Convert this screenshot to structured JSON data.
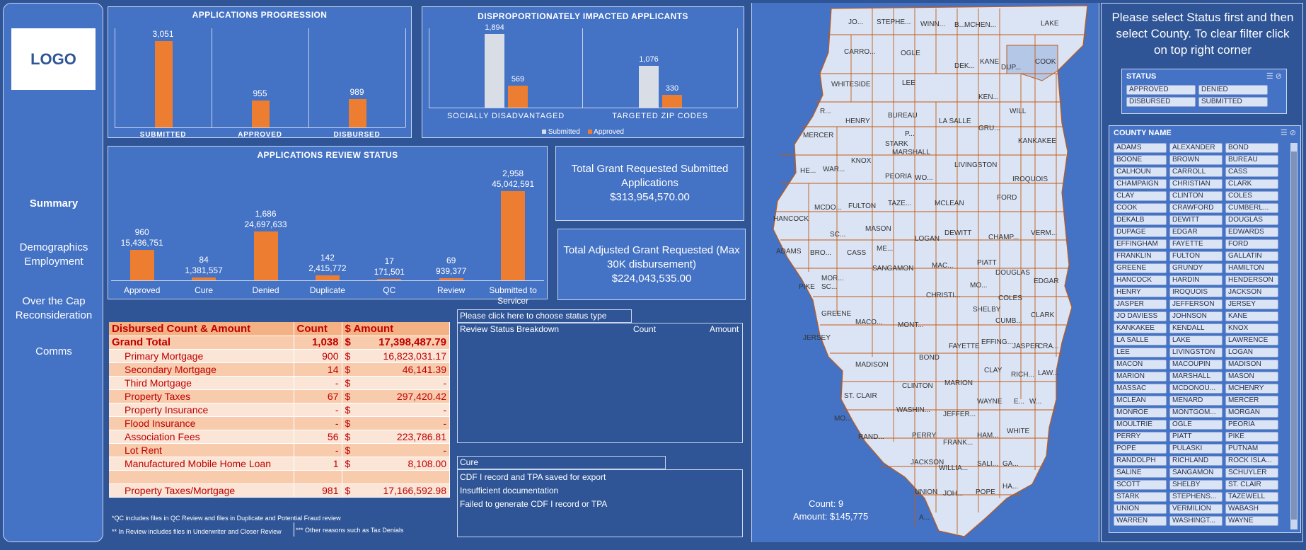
{
  "nav": {
    "logo": "LOGO",
    "items": [
      "Summary",
      "Demographics Employment",
      "Over the Cap Reconsideration",
      "Comms"
    ]
  },
  "progression": {
    "title": "APPLICATIONS PROGRESSION",
    "chart_data": {
      "type": "bar",
      "categories": [
        "SUBMITTED",
        "APPROVED",
        "DISBURSED"
      ],
      "values": [
        3051,
        955,
        989
      ],
      "value_labels": [
        "3,051",
        "955",
        "989"
      ],
      "ylim": [
        0,
        3300
      ]
    }
  },
  "disproportionate": {
    "title": "DISPROPORTIONATELY IMPACTED APPLICANTS",
    "chart_data": {
      "type": "bar",
      "categories": [
        "SOCIALLY DISADVANTAGED",
        "TARGETED ZIP CODES"
      ],
      "series": [
        {
          "name": "Submitted",
          "values": [
            1894,
            1076
          ],
          "labels": [
            "1,894",
            "1,076"
          ],
          "color": "#d9dde6"
        },
        {
          "name": "Approved",
          "values": [
            569,
            330
          ],
          "labels": [
            "569",
            "330"
          ],
          "color": "#ed7d31"
        }
      ],
      "ylim": [
        0,
        2000
      ],
      "legend": "bottom"
    }
  },
  "review": {
    "title": "APPLICATIONS REVIEW STATUS",
    "chart_data": {
      "type": "bar",
      "categories": [
        "Approved",
        "Cure",
        "Denied",
        "Duplicate",
        "QC",
        "Review",
        "Submitted to Servicer"
      ],
      "counts": [
        "960",
        "84",
        "1,686",
        "142",
        "17",
        "69",
        "2,958"
      ],
      "amounts_label": [
        "15,436,751",
        "1,381,557",
        "24,697,633",
        "2,415,772",
        "171,501",
        "939,377",
        "45,042,591"
      ],
      "values": [
        15436751,
        1381557,
        24697633,
        2415772,
        171501,
        939377,
        45042591
      ],
      "ylim": [
        0,
        48000000
      ]
    }
  },
  "kpi1": {
    "line1": "Total Grant Requested Submitted",
    "line2": "Applications",
    "value": "$313,954,570.00"
  },
  "kpi2": {
    "line1": "Total Adjusted Grant Requested (Max",
    "line2": "30K disbursement)",
    "value": "$224,043,535.00"
  },
  "disbursed": {
    "header": [
      "Disbursed Count & Amount",
      "Count",
      "$ Amount"
    ],
    "total": {
      "label": "Grand Total",
      "count": "1,038",
      "currency": "$",
      "amount": "17,398,487.79"
    },
    "rows": [
      {
        "label": "Primary Mortgage",
        "count": "900",
        "currency": "$",
        "amount": "16,823,031.17"
      },
      {
        "label": "Secondary Mortgage",
        "count": "14",
        "currency": "$",
        "amount": "46,141.39"
      },
      {
        "label": "Third Mortgage",
        "count": "-",
        "currency": "$",
        "amount": "-"
      },
      {
        "label": "Property Taxes",
        "count": "67",
        "currency": "$",
        "amount": "297,420.42"
      },
      {
        "label": "Property Insurance",
        "count": "-",
        "currency": "$",
        "amount": "-"
      },
      {
        "label": "Flood Insurance",
        "count": "-",
        "currency": "$",
        "amount": "-"
      },
      {
        "label": "Association Fees",
        "count": "56",
        "currency": "$",
        "amount": "223,786.81"
      },
      {
        "label": "Lot Rent",
        "count": "-",
        "currency": "$",
        "amount": "-"
      },
      {
        "label": "Manufactured Mobile Home Loan",
        "count": "1",
        "currency": "$",
        "amount": "8,108.00"
      },
      {
        "label": "",
        "count": "",
        "currency": "",
        "amount": ""
      },
      {
        "label": "Property Taxes/Mortgage",
        "count": "981",
        "currency": "$",
        "amount": "17,166,592.98"
      }
    ],
    "foot1": "*QC includes files in QC Review and files in Duplicate and Potential Fraud review",
    "foot2": "** In Review includes files in Underwriter and Closer Review",
    "foot3": "*** Other reasons such as Tax Denials"
  },
  "status_type": {
    "tab": "Please click here to choose status type",
    "columns": [
      "Review Status Breakdown",
      "Count",
      "Amount"
    ]
  },
  "cure": {
    "tab": "Cure",
    "lines": [
      "CDF I record and TPA saved for export",
      "Insufficient documentation",
      "Failed to generate CDF I record or TPA"
    ]
  },
  "map": {
    "count_label": "Count: 9",
    "amount_label": "Amount: $145,775",
    "fill": "#dbe4f5",
    "highlight": "#b4c7e7",
    "border": "#c55a11"
  },
  "filters": {
    "instructions": "Please select Status first and then select County.  To clear filter click on top right corner",
    "status_title": "STATUS",
    "status_items": [
      "APPROVED",
      "DENIED",
      "DISBURSED",
      "SUBMITTED"
    ],
    "county_title": "COUNTY NAME",
    "counties": [
      "ADAMS",
      "ALEXANDER",
      "BOND",
      "BOONE",
      "BROWN",
      "BUREAU",
      "CALHOUN",
      "CARROLL",
      "CASS",
      "CHAMPAIGN",
      "CHRISTIAN",
      "CLARK",
      "CLAY",
      "CLINTON",
      "COLES",
      "COOK",
      "CRAWFORD",
      "CUMBERL...",
      "DEKALB",
      "DEWITT",
      "DOUGLAS",
      "DUPAGE",
      "EDGAR",
      "EDWARDS",
      "EFFINGHAM",
      "FAYETTE",
      "FORD",
      "FRANKLIN",
      "FULTON",
      "GALLATIN",
      "GREENE",
      "GRUNDY",
      "HAMILTON",
      "HANCOCK",
      "HARDIN",
      "HENDERSON",
      "HENRY",
      "IROQUOIS",
      "JACKSON",
      "JASPER",
      "JEFFERSON",
      "JERSEY",
      "JO DAVIESS",
      "JOHNSON",
      "KANE",
      "KANKAKEE",
      "KENDALL",
      "KNOX",
      "LA SALLE",
      "LAKE",
      "LAWRENCE",
      "LEE",
      "LIVINGSTON",
      "LOGAN",
      "MACON",
      "MACOUPIN",
      "MADISON",
      "MARION",
      "MARSHALL",
      "MASON",
      "MASSAC",
      "MCDONOU...",
      "MCHENRY",
      "MCLEAN",
      "MENARD",
      "MERCER",
      "MONROE",
      "MONTGOM...",
      "MORGAN",
      "MOULTRIE",
      "OGLE",
      "PEORIA",
      "PERRY",
      "PIATT",
      "PIKE",
      "POPE",
      "PULASKI",
      "PUTNAM",
      "RANDOLPH",
      "RICHLAND",
      "ROCK ISLA...",
      "SALINE",
      "SANGAMON",
      "SCHUYLER",
      "SCOTT",
      "SHELBY",
      "ST. CLAIR",
      "STARK",
      "STEPHENS...",
      "TAZEWELL",
      "UNION",
      "VERMILION",
      "WABASH",
      "WARREN",
      "WASHINGT...",
      "WAYNE"
    ]
  }
}
